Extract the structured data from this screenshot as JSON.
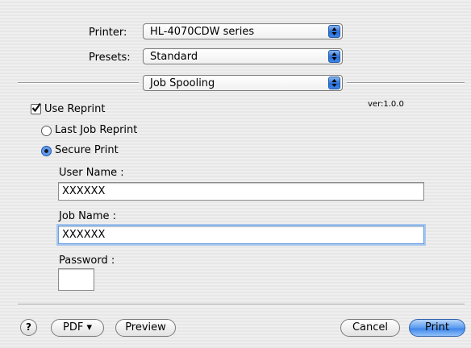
{
  "header": {
    "printer_label": "Printer:",
    "printer_value": "HL-4070CDW series",
    "presets_label": "Presets:",
    "presets_value": "Standard",
    "panel_value": "Job Spooling"
  },
  "job_spooling": {
    "use_reprint_label": "Use Reprint",
    "use_reprint_checked": true,
    "version": "ver:1.0.0",
    "options": [
      {
        "label": "Last Job Reprint",
        "selected": false
      },
      {
        "label": "Secure Print",
        "selected": true
      }
    ],
    "user_name_label": "User Name :",
    "user_name_value": "XXXXXX",
    "job_name_label": "Job Name :",
    "job_name_value": "XXXXXX",
    "password_label": "Password :",
    "password_value": ""
  },
  "footer": {
    "help_icon": "question-mark-icon",
    "help_glyph": "?",
    "pdf_label": "PDF ▾",
    "preview_label": "Preview",
    "cancel_label": "Cancel",
    "print_label": "Print"
  },
  "colors": {
    "accent": "#3f86ea",
    "background": "#ececec"
  }
}
